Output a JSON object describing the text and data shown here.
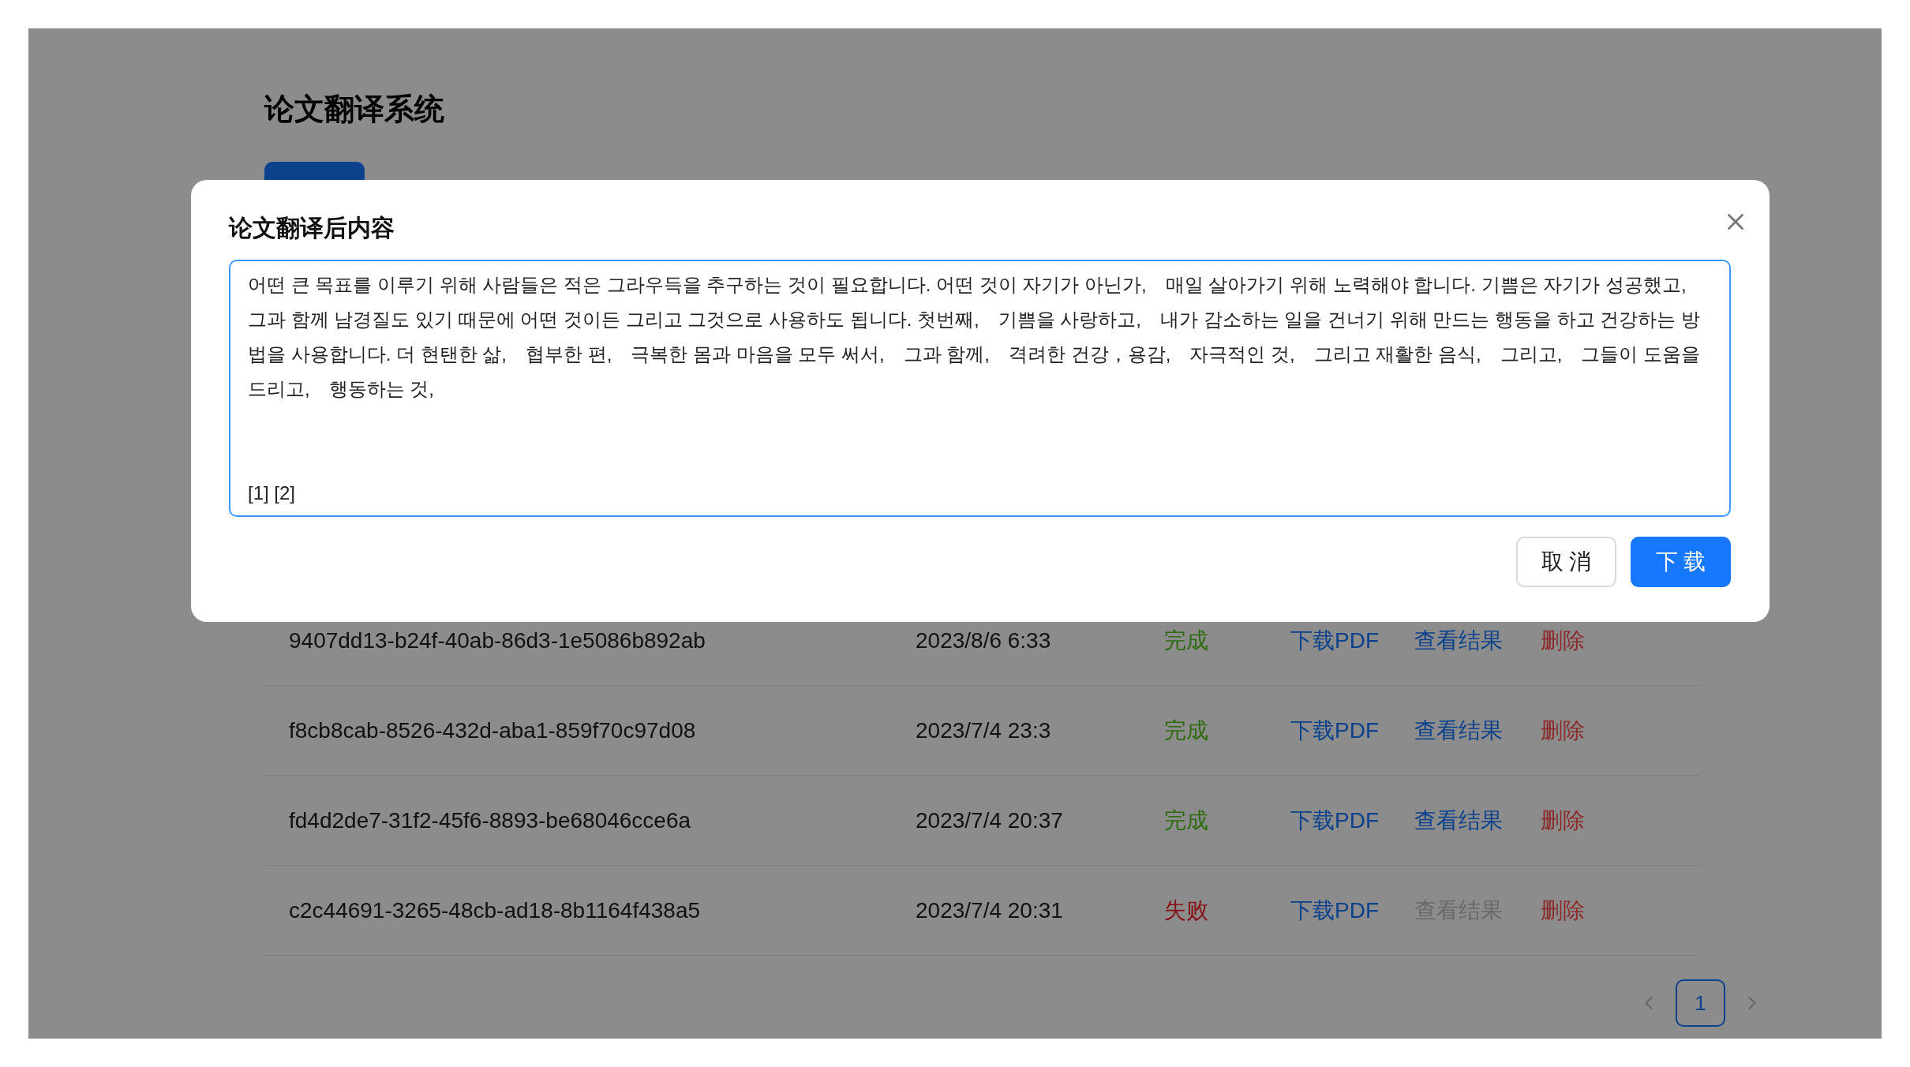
{
  "page": {
    "title": "论文翻译系统"
  },
  "table": {
    "rows": [
      {
        "id": "9407dd13-b24f-40ab-86d3-1e5086b892ab",
        "time": "2023/8/6 6:33",
        "status": {
          "kind": "done",
          "label": "完成"
        },
        "download": "下载PDF",
        "view": {
          "label": "查看结果",
          "disabled": false
        },
        "delete": "删除"
      },
      {
        "id": "f8cb8cab-8526-432d-aba1-859f70c97d08",
        "time": "2023/7/4 23:3",
        "status": {
          "kind": "done",
          "label": "完成"
        },
        "download": "下载PDF",
        "view": {
          "label": "查看结果",
          "disabled": false
        },
        "delete": "删除"
      },
      {
        "id": "fd4d2de7-31f2-45f6-8893-be68046cce6a",
        "time": "2023/7/4 20:37",
        "status": {
          "kind": "done",
          "label": "完成"
        },
        "download": "下载PDF",
        "view": {
          "label": "查看结果",
          "disabled": false
        },
        "delete": "删除"
      },
      {
        "id": "c2c44691-3265-48cb-ad18-8b1164f438a5",
        "time": "2023/7/4 20:31",
        "status": {
          "kind": "failed",
          "label": "失败"
        },
        "download": "下载PDF",
        "view": {
          "label": "查看结果",
          "disabled": true
        },
        "delete": "删除"
      }
    ]
  },
  "pagination": {
    "pages": [
      {
        "label": "1",
        "selected": true
      }
    ]
  },
  "dialog": {
    "title": "论文翻译后内容",
    "content": "어떤 큰 목표를 이루기 위해 사람들은 적은 그라우득을 추구하는 것이 필요합니다. 어떤 것이 자기가 아닌가,　매일 살아가기 위해 노력해야 합니다. 기쁨은 자기가 성공했고,　그과 함께 남경질도 있기 때문에 어떤 것이든 그리고 그것으로 사용하도 됩니다. 첫번째,　기쁨을 사랑하고,　내가 감소하는 일을 건너기 위해 만드는 행동을 하고 건강하는 방법을 사용합니다. 더 현탠한 삶,　협부한 편,　극복한 몸과 마음을 모두 써서,　그과 함께,　격려한 건강，용감,　자극적인 것,　그리고 재활한 음식,　그리고,　그들이 도움을 드리고,　행동하는 것,\n\n\n[1] [2]",
    "buttons": [
      {
        "label": "取 消",
        "kind": "secondary"
      },
      {
        "label": "下 载",
        "kind": "primary"
      }
    ]
  }
}
